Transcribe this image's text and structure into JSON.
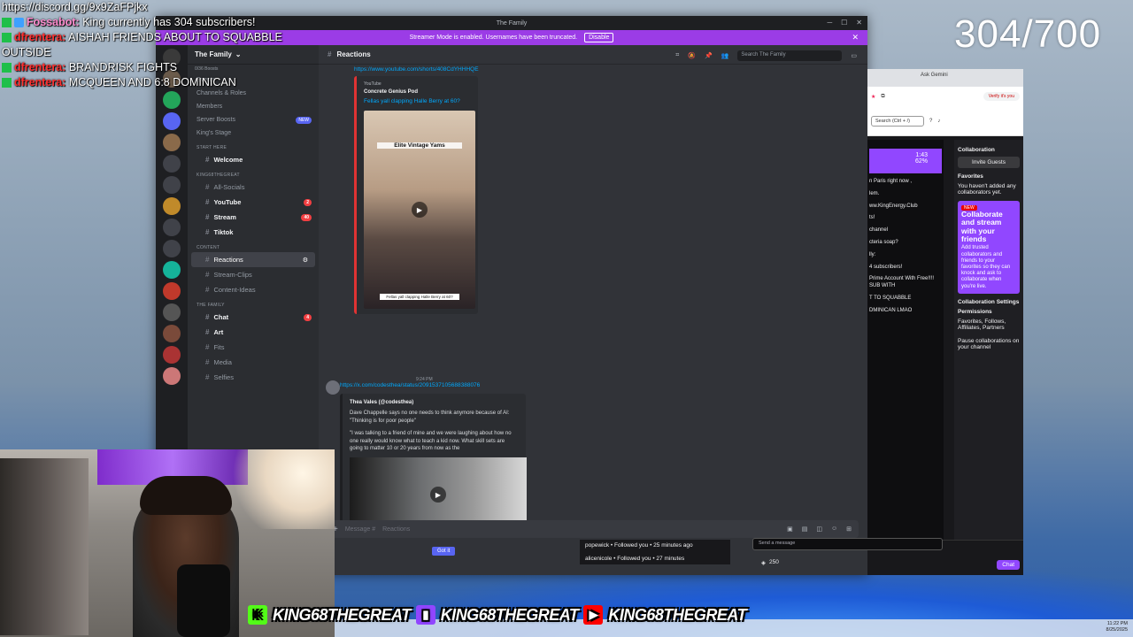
{
  "overlay": {
    "counter": "304/700",
    "chat": [
      {
        "user": "",
        "text": "https://discord.gg/9x9ZaFPjkx",
        "badge": "none"
      },
      {
        "user": "Fossabot:",
        "text": "King currently has 304 subscribers!",
        "badge": "bot"
      },
      {
        "user": "dfrentera:",
        "text": "AISHAH FRIENDS ABOUT TO SQUABBLE OUTSIDE",
        "badge": "sub"
      },
      {
        "user": "dfrentera:",
        "text": "BRANDRISK FIGHTS",
        "badge": "sub"
      },
      {
        "user": "dfrentera:",
        "text": "MCQUEEN AND 6:8 DOMINICAN",
        "badge": "sub"
      }
    ],
    "handles": [
      "KING68THEGREAT",
      "KING68THEGREAT",
      "KING68THEGREAT"
    ]
  },
  "discord": {
    "window_title": "The Family",
    "streamer_banner": "Streamer Mode is enabled. Usernames have been truncated.",
    "disable_label": "Disable",
    "guild_name": "The Family",
    "boosts": "0/36 Boosts",
    "static_items": [
      "Events",
      "Channels & Roles",
      "Members",
      "Server Boosts",
      "King's Stage"
    ],
    "new_label": "NEW",
    "categories": {
      "start": "START HERE",
      "king": "KING68THEGREAT",
      "content": "CONTENT",
      "family": "THE FAMILY"
    },
    "channels": {
      "welcome": "Welcome",
      "socials": "All-Socials",
      "youtube": "YouTube",
      "youtube_badge": "2",
      "stream": "Stream",
      "stream_badge": "40",
      "tiktok": "Tiktok",
      "reactions": "Reactions",
      "clips": "Stream-Clips",
      "ideas": "Content-Ideas",
      "chat": "Chat",
      "chat_badge": "4",
      "art": "Art",
      "fits": "Fits",
      "media": "Media",
      "selfies": "Selfies"
    },
    "header_channel": "Reactions",
    "search_placeholder": "Search The Family",
    "msg1": {
      "link": "https://www.youtube.com/shorts/408CdYHHHQE",
      "provider": "YouTube",
      "author": "Concrete Genius Pod",
      "title": "Fellas yall clapping Halle Berry at 60?",
      "thumb_caption": "Elite Vintage Yams",
      "thumb_subcaption": "Fellas yall clapping Halle Berry at 60?"
    },
    "msg2": {
      "time": "9:24 PM",
      "link": "https://x.com/codesthea/status/2091537105688388076",
      "tweet_name": "Thea Vales (@codesthea)",
      "tweet_line1": "Dave Chappelle says no one needs to think anymore because of AI: \"Thinking is for poor people\"",
      "tweet_line2": "\"I was talking to a friend of mine and we were laughing about how no one really would know what to teach a kid now. What skill sets are going to matter 10 or 20 years from now as the"
    },
    "composer_placeholder": "Message #",
    "composer_channel": "Reactions",
    "got_it": "Got it"
  },
  "twitch": {
    "tab_label": "Ask Gemini",
    "verify": "Verify it's you",
    "search_box": "Search (Ctrl + /)",
    "collab_menu": "Collaboration",
    "invite_guests": "Invite Guests",
    "uptime": "1:43",
    "percent": "62%",
    "favorites": "Favorites",
    "favorites_text": "You haven't added any collaborators yet.",
    "new_label": "NEW",
    "promo_title": "Collaborate and stream with your friends",
    "promo_body": "Add trusted collaborators and friends to your favorites so they can knock and ask to collaborate when you're live.",
    "settings_title": "Collaboration Settings",
    "permissions": "Permissions",
    "permissions_text": "Favorites, Follows, Affiliates, Partners",
    "pause_text": "Pause collaborations on your channel",
    "feed": [
      "n Paris right now ,",
      "lem.",
      "ww.KingEnergy.Club",
      "ts!",
      "channel",
      "cteria soap?",
      "lly:",
      "4 subscribers!",
      "Prime Account With Free!!!! SUB WITH",
      "T TO SQUABBLE",
      "DMINICAN LMAO"
    ],
    "followers": [
      "popewick • Followed you • 25 minutes ago",
      "alicenicole • Followed you • 27 minutes"
    ],
    "send_placeholder": "Send a message",
    "points": "250",
    "chat_button": "Chat"
  },
  "taskbar": {
    "time": "11:22 PM",
    "date": "8/25/2025"
  }
}
